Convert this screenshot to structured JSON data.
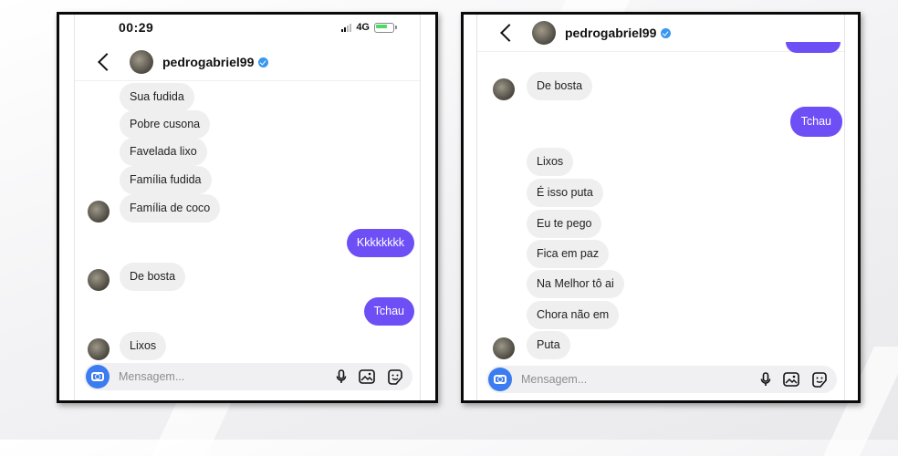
{
  "left_screen": {
    "status": {
      "time": "00:29",
      "network": "4G"
    },
    "header": {
      "username": "pedrogabriel99"
    },
    "messages": [
      {
        "text": "Sua fudida"
      },
      {
        "text": "Pobre cusona"
      },
      {
        "text": "Favelada lixo"
      },
      {
        "text": "Família fudida"
      },
      {
        "text": "Família de coco"
      },
      {
        "text": "Kkkkkkkk"
      },
      {
        "text": "De bosta"
      },
      {
        "text": "Tchau"
      },
      {
        "text": "Lixos"
      }
    ],
    "composer": {
      "placeholder": "Mensagem..."
    }
  },
  "right_screen": {
    "header": {
      "username": "pedrogabriel99"
    },
    "messages": [
      {
        "text": "De bosta"
      },
      {
        "text": "Tchau"
      },
      {
        "text": "Lixos"
      },
      {
        "text": "É isso puta"
      },
      {
        "text": "Eu te pego"
      },
      {
        "text": "Fica em paz"
      },
      {
        "text": "Na Melhor tô ai"
      },
      {
        "text": "Chora não em"
      },
      {
        "text": "Puta"
      }
    ],
    "composer": {
      "placeholder": "Mensagem..."
    }
  },
  "colors": {
    "outgoing_bubble": "#6e4ff6",
    "incoming_bubble": "#efefef",
    "verified": "#3897f0",
    "camera_button": "#3b7cf0"
  },
  "icons": [
    "back-icon",
    "verified-icon",
    "camera-icon",
    "microphone-icon",
    "image-icon",
    "sticker-icon",
    "signal-icon",
    "battery-icon"
  ]
}
